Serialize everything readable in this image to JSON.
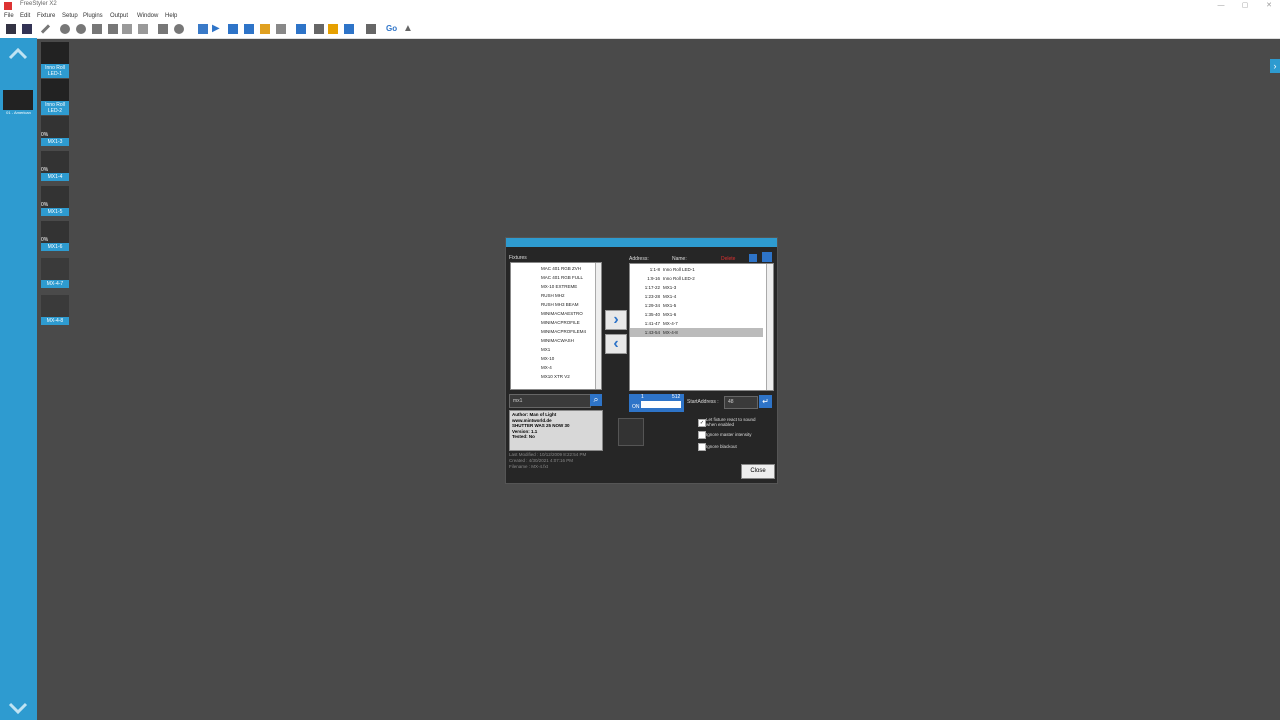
{
  "window": {
    "title": "FreeStyler X2"
  },
  "menu": [
    "File",
    "Edit",
    "Fixture",
    "Setup",
    "Plugins",
    "Output",
    "Window",
    "Help"
  ],
  "toolbar": {
    "go_label": "Go"
  },
  "left_fixture": {
    "label": "01 - American"
  },
  "fixtures_col": [
    {
      "label": "Inno Roll LED-1",
      "pct": ""
    },
    {
      "label": "Inno Roll LED-2",
      "pct": ""
    },
    {
      "label": "MX1-3",
      "pct": "0%"
    },
    {
      "label": "MX1-4",
      "pct": "0%"
    },
    {
      "label": "MX1-5",
      "pct": "0%"
    },
    {
      "label": "MX1-6",
      "pct": "0%"
    },
    {
      "label": "MX-4-7",
      "pct": ""
    },
    {
      "label": "MX-4-8",
      "pct": ""
    }
  ],
  "dialog": {
    "fixtures_label": "Fixtures",
    "address_label": "Address:",
    "name_label": "Name:",
    "delete_label": "Delete",
    "library": [
      "MAC 401 RGB ZVH",
      "MAC 401 RGB FULL",
      "MX-10 EXTREME",
      "RUSH MH2",
      "RUSH MH3 BEAM",
      "MINIMACMAESTRO",
      "MINIMACPROFILE",
      "MINIMACPROFILEM4",
      "MINIMACWASH",
      "MX1",
      "MX-10",
      "MX-4",
      "MX10 XTR V2"
    ],
    "patch": [
      {
        "addr": "1:1-8",
        "name": "Inno Roll LED-1"
      },
      {
        "addr": "1:9-16",
        "name": "Inno Roll LED-2"
      },
      {
        "addr": "1:17-22",
        "name": "MX1-3"
      },
      {
        "addr": "1:23-28",
        "name": "MX1-4"
      },
      {
        "addr": "1:29-34",
        "name": "MX1-5"
      },
      {
        "addr": "1:35-40",
        "name": "MX1-6"
      },
      {
        "addr": "1:41-47",
        "name": "MX-4-7"
      },
      {
        "addr": "1:43-54",
        "name": "MX-4-8"
      }
    ],
    "search_value": "mx1",
    "info": [
      "Author: Man of Light",
      "www.mintworld.de",
      "SHUTTER WAS 25 NOW 30",
      "Version: 1.1",
      "Tested: No"
    ],
    "meta": [
      "Last Modified : 10/12/2009 8:22:54 PM",
      "Created : 4/30/2021 4:07:16 PM",
      "Filename : MX-4.fxt"
    ],
    "dip": {
      "one": "1",
      "on": "ON",
      "max": "512"
    },
    "start_address_label": "StartAddress :",
    "start_address_value": "48",
    "opt1": "Let fixture react to sound when enabled",
    "opt2": "Ignore master intensity",
    "opt3": "Ignore blackout",
    "close_label": "Close"
  },
  "colors": {
    "accent": "#2e9bd0",
    "workspace": "#4a4a4a"
  }
}
